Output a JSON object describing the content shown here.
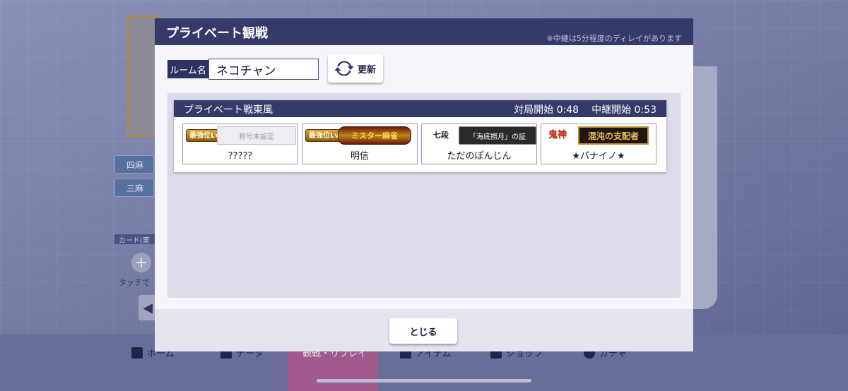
{
  "background": {
    "modes": [
      "四麻",
      "三麻"
    ],
    "card_label": "カード(東",
    "touch_hint": "タッチで",
    "nav": [
      "ホーム",
      "データ",
      "観戦・リプレイ",
      "アイテム",
      "ショップ",
      "ガチャ"
    ]
  },
  "dialog": {
    "title": "プライベート観戦",
    "delay_note": "※中継は5分程度のディレイがあります",
    "room_label": "ルーム名",
    "room_value": "ネコチャン",
    "refresh_label": "更新",
    "close_label": "とじる"
  },
  "match": {
    "name": "プライベート戦東風",
    "start_label": "対局開始",
    "start_time": "0:48",
    "relay_label": "中継開始",
    "relay_time": "0:53",
    "players": [
      {
        "rank": "最強位Lv2",
        "title": "称号未設定",
        "name": "?????"
      },
      {
        "rank": "最強位Lv3",
        "title": "ミスター麻雀",
        "name": "明信"
      },
      {
        "rank": "七段",
        "title": "「海底撈月」の証",
        "name": "ただのぽんじん"
      },
      {
        "rank": "鬼神",
        "title": "混沌の支配者",
        "name": "★パナイノ★"
      }
    ]
  },
  "colors": {
    "header_navy": "#363a6a",
    "panel_bg": "#f5f5fb",
    "list_bg": "#dcdce8"
  }
}
